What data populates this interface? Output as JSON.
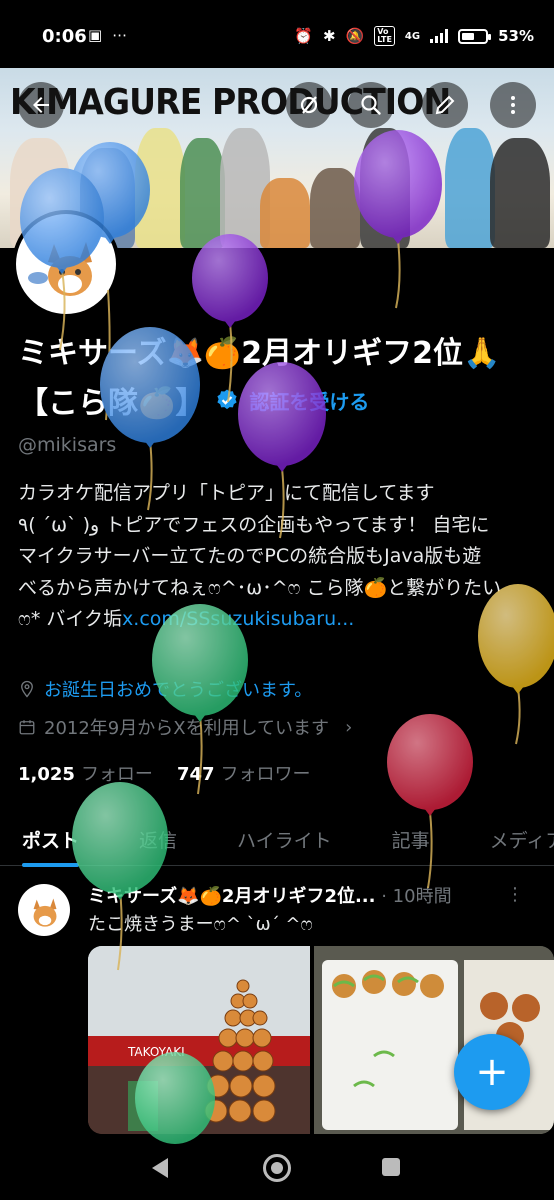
{
  "status_bar": {
    "time": "0:06",
    "left_icons": [
      "gallery-icon",
      "more-dots-icon"
    ],
    "network": "4G",
    "battery": "53%",
    "battery_level": 0.53
  },
  "banner": {
    "title": "KIMAGURE PRODUCTION"
  },
  "header_buttons": [
    "back-arrow-icon",
    "grok-icon",
    "search-icon",
    "edit-icon",
    "more-vertical-icon"
  ],
  "profile": {
    "name_line1": "ミキサーズ🦊🍊2月オリギフ2位🙏",
    "name_line2": "【こら隊🍊】",
    "verify_label": "認証を受ける",
    "handle": "@mikisars",
    "bio_line1": "カラオケ配信アプリ「トピア」にて配信してます",
    "bio_line2": "٩( ´ω` )و トピアでフェスの企画もやってます！ 自宅に",
    "bio_line3": "マイクラサーバー立てたのでPCの統合版もJava版も遊",
    "bio_line4": "べるから声かけてねぇෆ^･ω･^ෆ こら隊🍊と繋がりたい",
    "bio_line5_prefix": "ෆ* バイク垢",
    "bio_link": "x.com/SSsuzukisubaru...",
    "birthday": "お誕生日おめでとうございます。",
    "joined": "2012年9月からXを利用しています",
    "following_count": "1,025",
    "following_label": "フォロー",
    "followers_count": "747",
    "followers_label": "フォロワー"
  },
  "tabs": [
    {
      "label": "ポスト",
      "active": true
    },
    {
      "label": "返信",
      "active": false
    },
    {
      "label": "ハイライト",
      "active": false
    },
    {
      "label": "記事",
      "active": false
    },
    {
      "label": "メディア",
      "active": false
    }
  ],
  "post": {
    "author": "ミキサーズ🦊🍊2月オリギフ2位...",
    "time": "· 10時間",
    "text": "たこ焼きうまーෆ^ `ω´ ^ෆ",
    "sign_text": "TAKOYAKI"
  },
  "fab_label": "+",
  "colors": {
    "accent": "#1d9bf0",
    "muted": "#71767b",
    "balloon_blue": "#3d8ee8",
    "balloon_purple": "#8a38d6",
    "balloon_green": "#3fd18a",
    "balloon_yellow": "#f2c12e",
    "balloon_red": "#e0344e"
  }
}
